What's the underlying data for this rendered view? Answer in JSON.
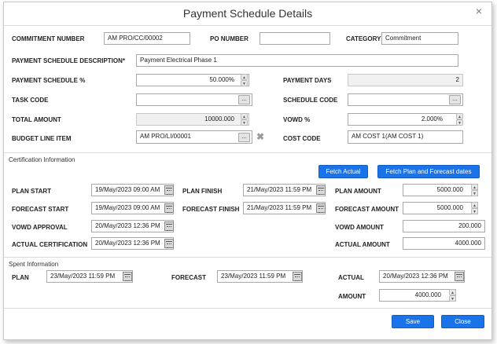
{
  "dialog": {
    "title": "Payment Schedule Details",
    "close_glyph": "×"
  },
  "fields": {
    "commitment_number": {
      "label": "COMMITMENT NUMBER",
      "value": "AM PRO/CC/00002"
    },
    "po_number": {
      "label": "PO NUMBER",
      "value": ""
    },
    "category": {
      "label": "CATEGORY",
      "value": "Commitment"
    },
    "description": {
      "label": "PAYMENT SCHEDULE DESCRIPTION*",
      "value": "Payment Electrical Phase 1"
    },
    "schedule_pct": {
      "label": "PAYMENT SCHEDULE %",
      "value": "50.000%"
    },
    "payment_days": {
      "label": "PAYMENT DAYS",
      "value": "2"
    },
    "task_code": {
      "label": "TASK CODE",
      "value": ""
    },
    "schedule_code": {
      "label": "SCHEDULE CODE",
      "value": ""
    },
    "total_amount": {
      "label": "TOTAL AMOUNT",
      "value": "10000.000"
    },
    "vowd_pct": {
      "label": "VOWD %",
      "value": "2.000%"
    },
    "budget_line_item": {
      "label": "BUDGET LINE ITEM",
      "value": "AM PRO/LI/00001"
    },
    "cost_code": {
      "label": "COST CODE",
      "value": "AM COST 1(AM COST 1)"
    }
  },
  "certification": {
    "heading": "Certification Information",
    "fetch_actual": "Fetch Actual",
    "fetch_plan": "Fetch Plan and Forecast dates",
    "plan_start": {
      "label": "PLAN START",
      "value": "19/May/2023 09:00 AM"
    },
    "forecast_start": {
      "label": "FORECAST START",
      "value": "19/May/2023 09:00 AM"
    },
    "vowd_approval": {
      "label": "VOWD APPROVAL",
      "value": "20/May/2023 12:36 PM"
    },
    "actual_certification": {
      "label": "ACTUAL CERTIFICATION",
      "value": "20/May/2023 12:36 PM"
    },
    "plan_finish": {
      "label": "PLAN FINISH",
      "value": "21/May/2023 11:59 PM"
    },
    "forecast_finish": {
      "label": "FORECAST FINISH",
      "value": "21/May/2023 11:59 PM"
    },
    "plan_amount": {
      "label": "PLAN AMOUNT",
      "value": "5000.000"
    },
    "forecast_amount": {
      "label": "FORECAST AMOUNT",
      "value": "5000.000"
    },
    "vowd_amount": {
      "label": "VOWD AMOUNT",
      "value": "200.000"
    },
    "actual_amount": {
      "label": "ACTUAL AMOUNT",
      "value": "4000.000"
    }
  },
  "spent": {
    "heading": "Spent Information",
    "plan": {
      "label": "PLAN",
      "value": "23/May/2023 11:59 PM"
    },
    "forecast": {
      "label": "FORECAST",
      "value": "23/May/2023 11:59 PM"
    },
    "actual": {
      "label": "ACTUAL",
      "value": "20/May/2023 12:36 PM"
    },
    "amount": {
      "label": "AMOUNT",
      "value": "4000.000"
    }
  },
  "footer": {
    "save": "Save",
    "close": "Close"
  },
  "icons": {
    "spinner_up": "▲",
    "spinner_down": "▼",
    "ellipsis": "...",
    "clear": "✖"
  },
  "colors": {
    "primary_button": "#1a73e8"
  }
}
